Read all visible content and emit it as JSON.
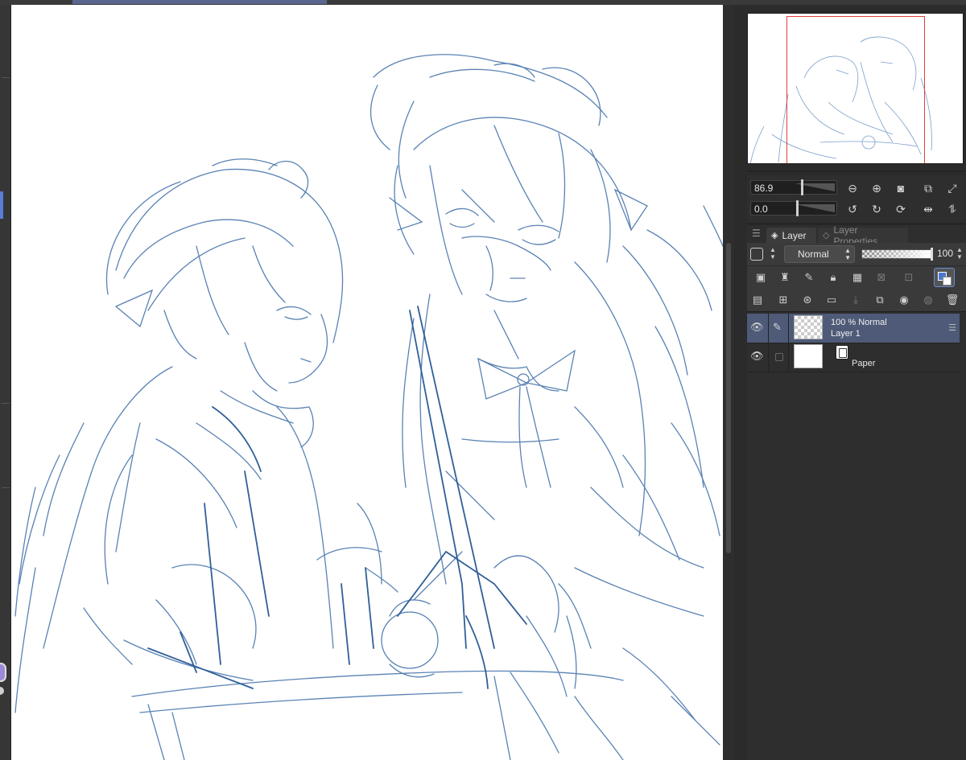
{
  "navigator_controls": {
    "zoom_value": "86.9",
    "rotate_value": "0.0"
  },
  "layer_panel": {
    "tabs": [
      {
        "label": "Layer",
        "active": true
      },
      {
        "label": "Layer Properties",
        "active": false
      }
    ],
    "blend_mode": "Normal",
    "opacity": "100",
    "layers": [
      {
        "line1": "100 %  Normal",
        "line2": "Layer 1",
        "selected": true
      },
      {
        "name": "Paper",
        "selected": false
      }
    ]
  },
  "colors": {
    "accent": "#4e5a78",
    "sketch_stroke": "#3d6da6",
    "viewbox_red": "#e0403c",
    "main_color": "#4a78d0"
  },
  "icons": {
    "zoom_out": "minus-circle-icon",
    "zoom_in": "plus-circle-icon",
    "fit": "stop-circle-icon",
    "rotate_left": "rotate-ccw-icon",
    "rotate_right": "rotate-cw-icon",
    "reset_rotate": "reset-rotation-icon",
    "flip_h": "flip-horizontal-icon",
    "flip_v": "flip-vertical-icon"
  }
}
